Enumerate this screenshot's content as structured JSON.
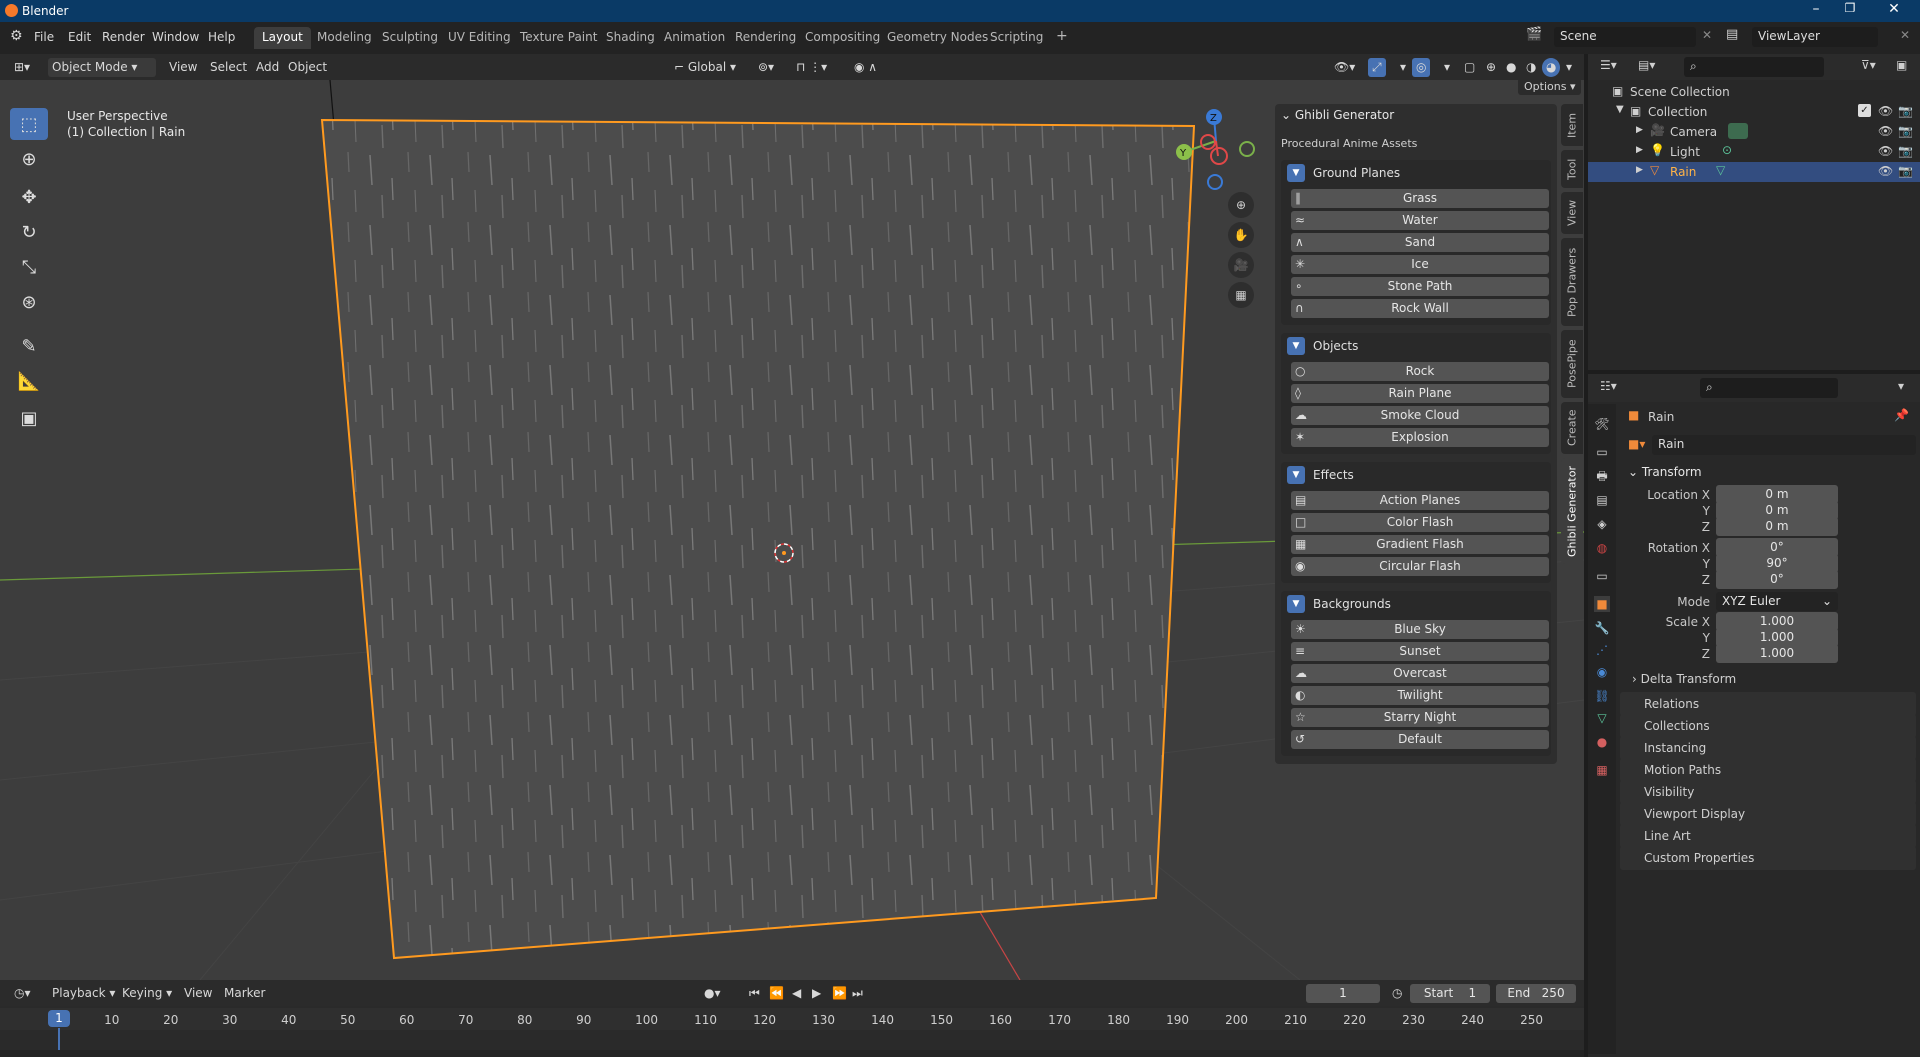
{
  "title_bar": {
    "app_title": "Blender",
    "minimize": "–",
    "maximize": "❐",
    "close": "✕"
  },
  "menu": {
    "file": "File",
    "edit": "Edit",
    "render": "Render",
    "window": "Window",
    "help": "Help"
  },
  "workspaces": [
    "Layout",
    "Modeling",
    "Sculpting",
    "UV Editing",
    "Texture Paint",
    "Shading",
    "Animation",
    "Rendering",
    "Compositing",
    "Geometry Nodes",
    "Scripting"
  ],
  "add_workspace": "+",
  "scene": {
    "scene_name": "Scene",
    "view_layer": "ViewLayer"
  },
  "viewport_header": {
    "mode": "Object Mode",
    "view": "View",
    "select": "Select",
    "add": "Add",
    "object": "Object",
    "orientation": "Global",
    "options": "Options"
  },
  "viewport": {
    "perspective": "User Perspective",
    "collection_info": "(1) Collection | Rain"
  },
  "gizmo": {
    "z": "Z",
    "y": "Y"
  },
  "npanel": {
    "title": "Ghibli Generator",
    "subtitle": "Procedural Anime Assets",
    "sections": [
      {
        "label": "Ground Planes",
        "items": [
          {
            "label": "Grass",
            "icon": "∥"
          },
          {
            "label": "Water",
            "icon": "≈"
          },
          {
            "label": "Sand",
            "icon": "∧"
          },
          {
            "label": "Ice",
            "icon": "✳"
          },
          {
            "label": "Stone Path",
            "icon": "∘"
          },
          {
            "label": "Rock Wall",
            "icon": "∩"
          }
        ]
      },
      {
        "label": "Objects",
        "items": [
          {
            "label": "Rock",
            "icon": "○"
          },
          {
            "label": "Rain Plane",
            "icon": "◊"
          },
          {
            "label": "Smoke Cloud",
            "icon": "☁"
          },
          {
            "label": "Explosion",
            "icon": "✶"
          }
        ]
      },
      {
        "label": "Effects",
        "items": [
          {
            "label": "Action Planes",
            "icon": "▤"
          },
          {
            "label": "Color Flash",
            "icon": "□"
          },
          {
            "label": "Gradient Flash",
            "icon": "▦"
          },
          {
            "label": "Circular Flash",
            "icon": "◉"
          }
        ]
      },
      {
        "label": "Backgrounds",
        "items": [
          {
            "label": "Blue Sky",
            "icon": "☀"
          },
          {
            "label": "Sunset",
            "icon": "≡"
          },
          {
            "label": "Overcast",
            "icon": "☁"
          },
          {
            "label": "Twilight",
            "icon": "◐"
          },
          {
            "label": "Starry Night",
            "icon": "☆"
          },
          {
            "label": "Default",
            "icon": "↺"
          }
        ]
      }
    ]
  },
  "side_tabs": [
    "Item",
    "Tool",
    "View",
    "Pop Drawers",
    "PosePipe",
    "Create",
    "Ghibli Generator"
  ],
  "outliner": {
    "root": "Scene Collection",
    "collection": "Collection",
    "objects": [
      "Camera",
      "Light",
      "Rain"
    ]
  },
  "properties": {
    "object_name": "Rain",
    "data_name": "Rain",
    "transform_label": "Transform",
    "location_label": "Location X",
    "rotation_label": "Rotation X",
    "scale_label": "Scale X",
    "y": "Y",
    "z": "Z",
    "location": [
      "0 m",
      "0 m",
      "0 m"
    ],
    "rotation": [
      "0°",
      "90°",
      "0°"
    ],
    "mode_label": "Mode",
    "mode_value": "XYZ Euler",
    "scale": [
      "1.000",
      "1.000",
      "1.000"
    ],
    "delta_transform": "Delta Transform",
    "panels": [
      "Relations",
      "Collections",
      "Instancing",
      "Motion Paths",
      "Visibility",
      "Viewport Display",
      "Line Art",
      "Custom Properties"
    ]
  },
  "timeline": {
    "playback": "Playback",
    "keying": "Keying",
    "view": "View",
    "marker": "Marker",
    "current_frame": "1",
    "start_label": "Start",
    "start": "1",
    "end_label": "End",
    "end": "250",
    "ruler": [
      "1",
      "10",
      "20",
      "30",
      "40",
      "50",
      "60",
      "70",
      "80",
      "90",
      "100",
      "110",
      "120",
      "130",
      "140",
      "150",
      "160",
      "170",
      "180",
      "190",
      "200",
      "210",
      "220",
      "230",
      "240",
      "250"
    ]
  },
  "colors": {
    "accent": "#4772b3",
    "selection": "#ff9a1f",
    "x_axis": "#c84545",
    "y_axis": "#6a9a3a"
  }
}
